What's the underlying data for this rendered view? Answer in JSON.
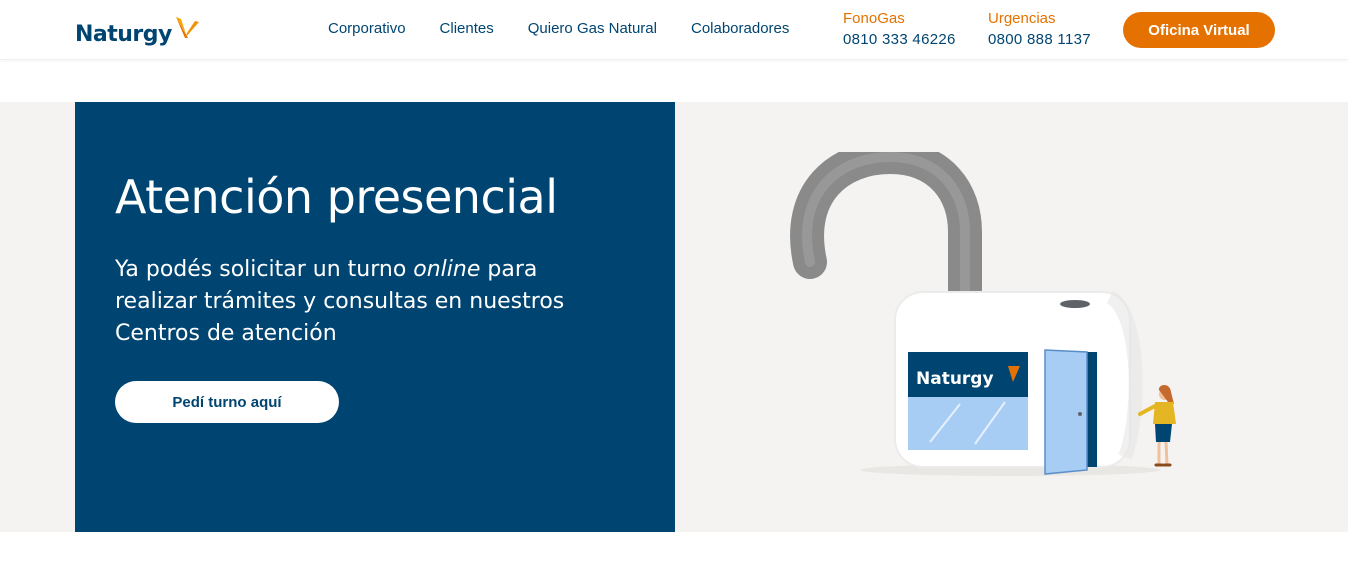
{
  "header": {
    "logo": {
      "text": "Naturgy"
    },
    "nav": [
      {
        "label": "Corporativo"
      },
      {
        "label": "Clientes"
      },
      {
        "label": "Quiero Gas Natural"
      },
      {
        "label": "Colaboradores"
      }
    ],
    "fonogas": {
      "label": "FonoGas",
      "phone": "0810 333 46226"
    },
    "urgencias": {
      "label": "Urgencias",
      "phone": "0800 888 1137"
    },
    "oficina_virtual_label": "Oficina Virtual"
  },
  "hero": {
    "title": "Atención presencial",
    "text_before": "Ya podés solicitar un turno ",
    "text_italic": "online",
    "text_after": " para realizar trámites y consultas en nuestros Centros de atención",
    "cta_label": "Pedí turno aquí",
    "illustration": {
      "sign_text": "Naturgy"
    }
  },
  "colors": {
    "brand_blue": "#004571",
    "brand_orange": "#e57200",
    "hero_background": "#f4f3f1"
  },
  "icons": {
    "logo_mark": "naturgy-butterfly-icon",
    "illustration": "padlock-store-illustration"
  }
}
